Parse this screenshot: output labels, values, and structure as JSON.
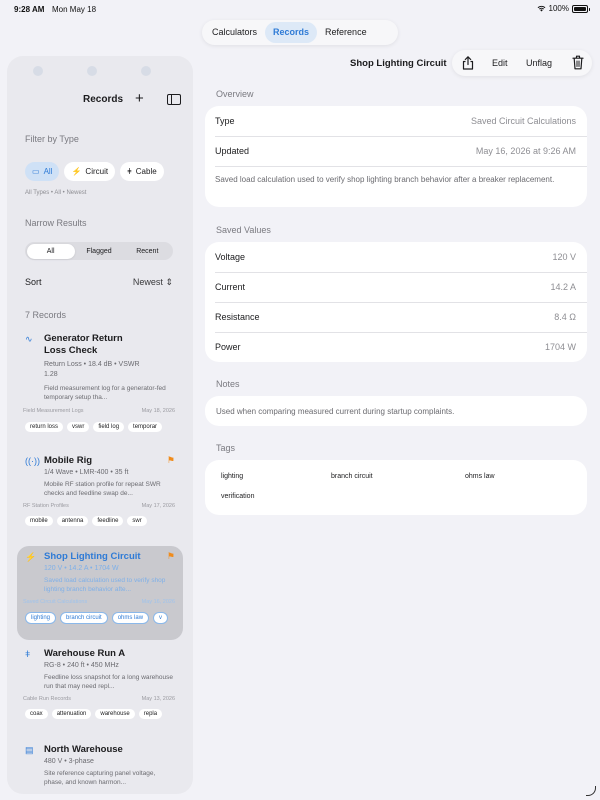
{
  "status": {
    "time": "9:28 AM",
    "date": "Mon May 18",
    "battery": "100%"
  },
  "top_tabs": [
    {
      "label": "Calculators"
    },
    {
      "label": "Records"
    },
    {
      "label": "Reference"
    }
  ],
  "sidebar": {
    "title": "Records",
    "filter_label": "Filter by Type",
    "type_chips": [
      {
        "label": "All",
        "icon": "folder-icon"
      },
      {
        "label": "Circuit",
        "icon": "circuit-icon"
      },
      {
        "label": "Cable",
        "icon": "cable-icon"
      }
    ],
    "filter_summary": "All Types • All • Newest",
    "narrow_label": "Narrow Results",
    "narrow_options": [
      "All",
      "Flagged",
      "Recent"
    ],
    "sort_label": "Sort",
    "sort_value": "Newest",
    "records_count": "7 Records",
    "records": [
      {
        "title": "Generator Return Loss Check",
        "subtitle": "Return Loss • 18.4 dB • VSWR 1.28",
        "desc": "Field measurement log for a generator-fed temporary setup tha...",
        "category": "Field Measurement Logs",
        "date": "May 18, 2026",
        "flagged": false,
        "tags": [
          "return loss",
          "vswr",
          "field log",
          "temporar"
        ]
      },
      {
        "title": "Mobile Rig",
        "subtitle": "1/4 Wave • LMR-400 • 35 ft",
        "desc": "Mobile RF station profile for repeat SWR checks and feedline swap de...",
        "category": "RF Station Profiles",
        "date": "May 17, 2026",
        "flagged": true,
        "tags": [
          "mobile",
          "antenna",
          "feedline",
          "swr"
        ]
      },
      {
        "title": "Shop Lighting Circuit",
        "subtitle": "120 V • 14.2 A • 1704 W",
        "desc": "Saved load calculation used to verify shop lighting branch behavior afte...",
        "category": "Saved Circuit Calculations",
        "date": "May 16, 2026",
        "flagged": true,
        "tags": [
          "lighting",
          "branch circuit",
          "ohms law",
          "v"
        ]
      },
      {
        "title": "Warehouse Run A",
        "subtitle": "RG-8 • 240 ft • 450 MHz",
        "desc": "Feedline loss snapshot for a long warehouse run that may need repl...",
        "category": "Cable Run Records",
        "date": "May 13, 2026",
        "flagged": false,
        "tags": [
          "coax",
          "attenuation",
          "warehouse",
          "repla"
        ]
      },
      {
        "title": "North Warehouse",
        "subtitle": "480 V • 3-phase",
        "desc": "Site reference capturing panel voltage, phase, and known harmon...",
        "category": "",
        "date": "",
        "flagged": false,
        "tags": []
      }
    ]
  },
  "detail": {
    "title": "Shop Lighting Circuit",
    "actions": {
      "edit": "Edit",
      "unflag": "Unflag"
    },
    "overview_label": "Overview",
    "overview": {
      "type_label": "Type",
      "type_value": "Saved Circuit Calculations",
      "updated_label": "Updated",
      "updated_value": "May 16, 2026 at 9:26 AM",
      "description": "Saved load calculation used to verify shop lighting branch behavior after a breaker replacement."
    },
    "saved_values_label": "Saved Values",
    "saved_values": [
      {
        "label": "Voltage",
        "value": "120 V"
      },
      {
        "label": "Current",
        "value": "14.2 A"
      },
      {
        "label": "Resistance",
        "value": "8.4 Ω"
      },
      {
        "label": "Power",
        "value": "1704 W"
      }
    ],
    "notes_label": "Notes",
    "notes": "Used when comparing measured current during startup complaints.",
    "tags_label": "Tags",
    "tags": [
      "lighting",
      "branch circuit",
      "ohms law",
      "verification"
    ]
  },
  "colors": {
    "accent": "#2f7bd6",
    "flag": "#f08c1c",
    "background": "#f2f2f7",
    "sidebar": "#e9e9ee"
  }
}
